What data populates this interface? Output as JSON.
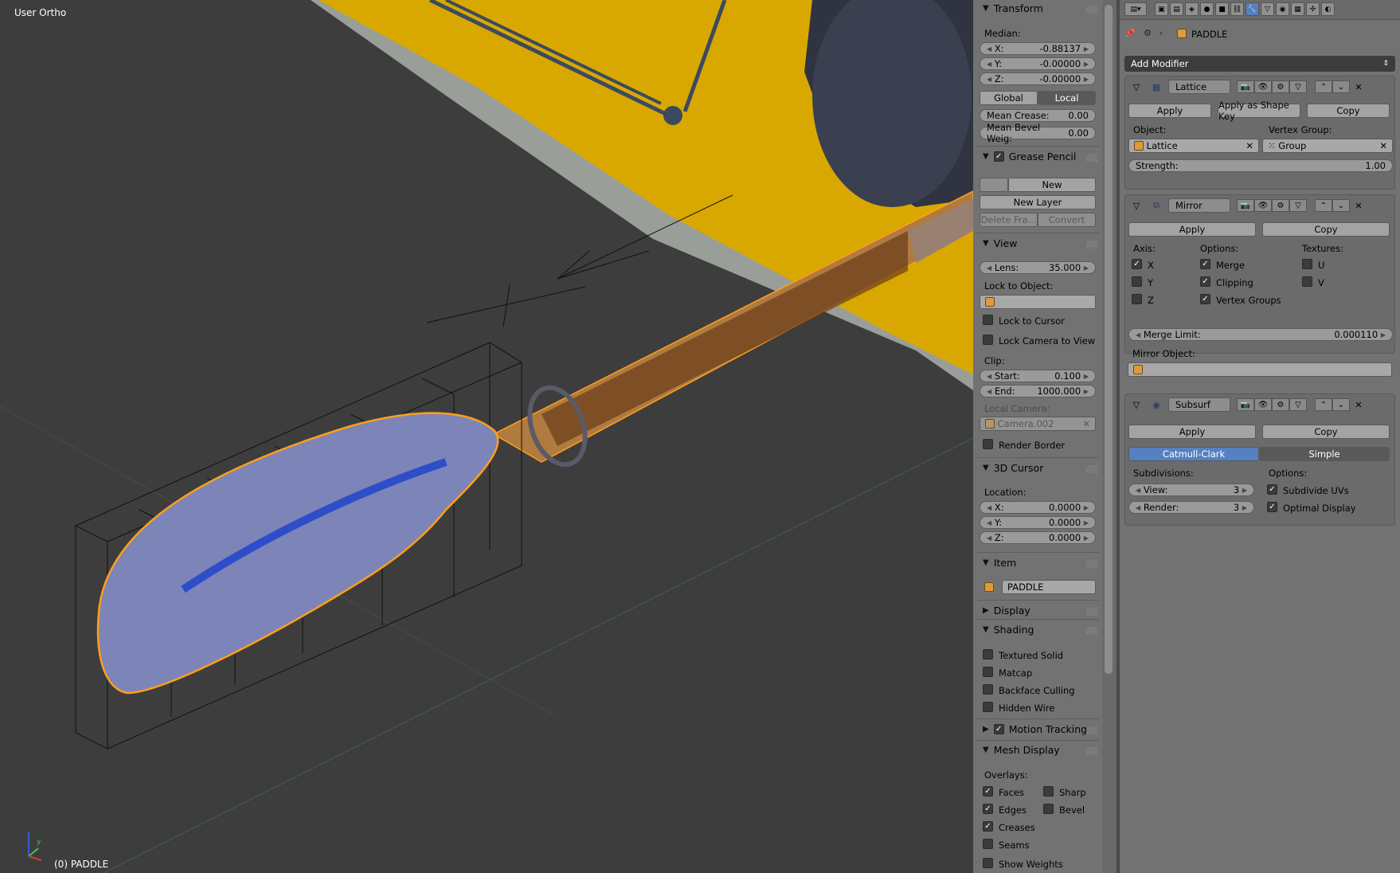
{
  "viewport": {
    "view_label": "User Ortho",
    "object_label": "(0) PADDLE",
    "axis_labels": {
      "x": "x",
      "y": "y",
      "z": "z"
    }
  },
  "npanel": {
    "transform": {
      "title": "Transform",
      "median_label": "Median:",
      "x_label": "X:",
      "x_value": "-0.88137",
      "y_label": "Y:",
      "y_value": "-0.00000",
      "z_label": "Z:",
      "z_value": "-0.00000",
      "global_label": "Global",
      "local_label": "Local",
      "mean_crease_label": "Mean Crease:",
      "mean_crease_value": "0.00",
      "mean_bevel_label": "Mean Bevel Weig:",
      "mean_bevel_value": "0.00"
    },
    "grease_pencil": {
      "title": "Grease Pencil",
      "new_label": "New",
      "new_layer_label": "New Layer",
      "delete_frame_label": "Delete Fra...",
      "convert_label": "Convert"
    },
    "view": {
      "title": "View",
      "lens_label": "Lens:",
      "lens_value": "35.000",
      "lock_to_object_label": "Lock to Object:",
      "lock_to_cursor_label": "Lock to Cursor",
      "lock_camera_label": "Lock Camera to View",
      "clip_label": "Clip:",
      "start_label": "Start:",
      "start_value": "0.100",
      "end_label": "End:",
      "end_value": "1000.000",
      "local_camera_label": "Local Camera:",
      "local_camera_value": "Camera.002",
      "render_border_label": "Render Border"
    },
    "cursor": {
      "title": "3D Cursor",
      "location_label": "Location:",
      "x_label": "X:",
      "x_value": "0.0000",
      "y_label": "Y:",
      "y_value": "0.0000",
      "z_label": "Z:",
      "z_value": "0.0000"
    },
    "item": {
      "title": "Item",
      "name": "PADDLE"
    },
    "display": {
      "title": "Display"
    },
    "shading": {
      "title": "Shading",
      "textured_solid": "Textured Solid",
      "matcap": "Matcap",
      "backface_culling": "Backface Culling",
      "hidden_wire": "Hidden Wire"
    },
    "motion_tracking": {
      "title": "Motion Tracking"
    },
    "mesh_display": {
      "title": "Mesh Display",
      "overlays_label": "Overlays:",
      "faces": "Faces",
      "sharp": "Sharp",
      "edges": "Edges",
      "bevel": "Bevel",
      "creases": "Creases",
      "seams": "Seams",
      "show_weights": "Show Weights"
    }
  },
  "properties": {
    "object_name": "PADDLE",
    "add_modifier_label": "Add Modifier",
    "lattice": {
      "name": "Lattice",
      "apply_label": "Apply",
      "apply_shape_key_label": "Apply as Shape Key",
      "copy_label": "Copy",
      "object_label": "Object:",
      "object_value": "Lattice",
      "vertex_group_label": "Vertex Group:",
      "vertex_group_value": "Group",
      "strength_label": "Strength:",
      "strength_value": "1.00"
    },
    "mirror": {
      "name": "Mirror",
      "apply_label": "Apply",
      "copy_label": "Copy",
      "axis_label": "Axis:",
      "options_label": "Options:",
      "textures_label": "Textures:",
      "x": "X",
      "y": "Y",
      "z": "Z",
      "merge": "Merge",
      "clipping": "Clipping",
      "vertex_groups": "Vertex Groups",
      "u": "U",
      "v": "V",
      "merge_limit_label": "Merge Limit:",
      "merge_limit_value": "0.000110",
      "mirror_object_label": "Mirror Object:"
    },
    "subsurf": {
      "name": "Subsurf",
      "apply_label": "Apply",
      "copy_label": "Copy",
      "catmull_label": "Catmull-Clark",
      "simple_label": "Simple",
      "subdivisions_label": "Subdivisions:",
      "options_label": "Options:",
      "view_label": "View:",
      "view_value": "3",
      "render_label": "Render:",
      "render_value": "3",
      "subdivide_uvs": "Subdivide UVs",
      "optimal_display": "Optimal Display"
    }
  }
}
